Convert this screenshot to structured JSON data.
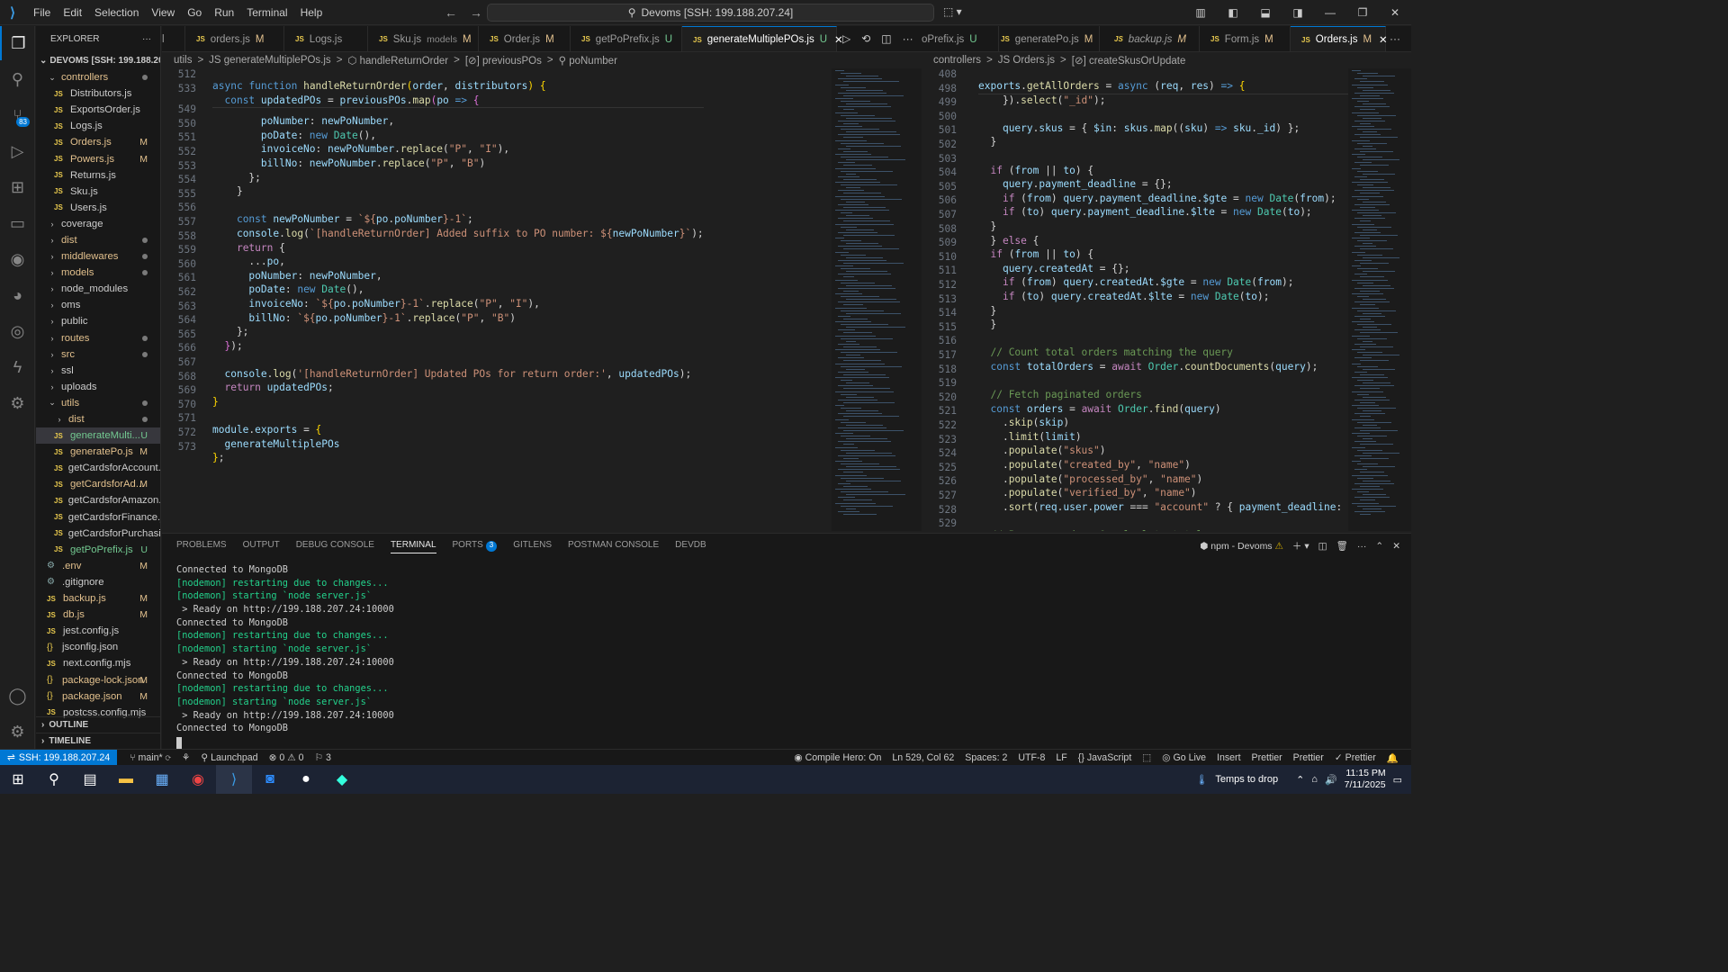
{
  "titlebar": {
    "menu": [
      "File",
      "Edit",
      "Selection",
      "View",
      "Go",
      "Run",
      "Terminal",
      "Help"
    ],
    "search": "Devoms [SSH: 199.188.207.24]"
  },
  "activity": {
    "source_control_badge": "83"
  },
  "explorer": {
    "title": "EXPLORER",
    "project": "DEVOMS [SSH: 199.188.20...",
    "rows": [
      {
        "label": "controllers",
        "type": "folder-open",
        "indent": 1,
        "dot": true
      },
      {
        "label": "Distributors.js",
        "type": "js",
        "indent": 2
      },
      {
        "label": "ExportsOrder.js",
        "type": "js",
        "indent": 2
      },
      {
        "label": "Logs.js",
        "type": "js",
        "indent": 2
      },
      {
        "label": "Orders.js",
        "type": "js",
        "indent": 2,
        "status": "M"
      },
      {
        "label": "Powers.js",
        "type": "js",
        "indent": 2,
        "status": "M"
      },
      {
        "label": "Returns.js",
        "type": "js",
        "indent": 2
      },
      {
        "label": "Sku.js",
        "type": "js",
        "indent": 2
      },
      {
        "label": "Users.js",
        "type": "js",
        "indent": 2
      },
      {
        "label": "coverage",
        "type": "folder",
        "indent": 1
      },
      {
        "label": "dist",
        "type": "folder",
        "indent": 1,
        "dot": true
      },
      {
        "label": "middlewares",
        "type": "folder",
        "indent": 1,
        "dot": true
      },
      {
        "label": "models",
        "type": "folder",
        "indent": 1,
        "dot": true
      },
      {
        "label": "node_modules",
        "type": "folder",
        "indent": 1
      },
      {
        "label": "oms",
        "type": "folder",
        "indent": 1
      },
      {
        "label": "public",
        "type": "folder",
        "indent": 1
      },
      {
        "label": "routes",
        "type": "folder",
        "indent": 1,
        "dot": true
      },
      {
        "label": "src",
        "type": "folder",
        "indent": 1,
        "dot": true
      },
      {
        "label": "ssl",
        "type": "folder",
        "indent": 1
      },
      {
        "label": "uploads",
        "type": "folder",
        "indent": 1
      },
      {
        "label": "utils",
        "type": "folder-open",
        "indent": 1,
        "dot": true
      },
      {
        "label": "dist",
        "type": "folder",
        "indent": 2,
        "dot": true
      },
      {
        "label": "generateMulti...",
        "type": "js",
        "indent": 2,
        "status": "U",
        "selected": true
      },
      {
        "label": "generatePo.js",
        "type": "js",
        "indent": 2,
        "status": "M"
      },
      {
        "label": "getCardsforAccount.js",
        "type": "js",
        "indent": 2
      },
      {
        "label": "getCardsforAd...",
        "type": "js",
        "indent": 2,
        "status": "M"
      },
      {
        "label": "getCardsforAmazon.js",
        "type": "js",
        "indent": 2
      },
      {
        "label": "getCardsforFinance.js",
        "type": "js",
        "indent": 2
      },
      {
        "label": "getCardsforPurchasi...",
        "type": "js",
        "indent": 2
      },
      {
        "label": "getPoPrefix.js",
        "type": "js",
        "indent": 2,
        "status": "U"
      },
      {
        "label": ".env",
        "type": "gear",
        "indent": 1,
        "status": "M"
      },
      {
        "label": ".gitignore",
        "type": "gear",
        "indent": 1
      },
      {
        "label": "backup.js",
        "type": "js",
        "indent": 1,
        "status": "M"
      },
      {
        "label": "db.js",
        "type": "js",
        "indent": 1,
        "status": "M"
      },
      {
        "label": "jest.config.js",
        "type": "js",
        "indent": 1
      },
      {
        "label": "jsconfig.json",
        "type": "json",
        "indent": 1
      },
      {
        "label": "next.config.mjs",
        "type": "js",
        "indent": 1
      },
      {
        "label": "package-lock.json",
        "type": "json",
        "indent": 1,
        "status": "M"
      },
      {
        "label": "package.json",
        "type": "json",
        "indent": 1,
        "status": "M"
      },
      {
        "label": "postcss.config.mjs",
        "type": "js",
        "indent": 1
      }
    ],
    "outline": "OUTLINE",
    "timeline": "TIMELINE"
  },
  "tabs_left": [
    {
      "label": "orders.js",
      "status": "M"
    },
    {
      "label": "Logs.js",
      "status": ""
    },
    {
      "label": "Sku.js",
      "sub": "models",
      "status": "M"
    },
    {
      "label": "Order.js",
      "status": "M"
    },
    {
      "label": "getPoPrefix.js",
      "status": "U"
    },
    {
      "label": "generateMultiplePOs.js",
      "status": "U",
      "active": true
    }
  ],
  "tabs_right": [
    {
      "label": "oPrefix.js",
      "status": "U"
    },
    {
      "label": "generatePo.js",
      "status": "M"
    },
    {
      "label": "backup.js",
      "status": "M"
    },
    {
      "label": "Form.js",
      "status": "M"
    },
    {
      "label": "Orders.js",
      "status": "M",
      "active": true
    }
  ],
  "breadcrumbs_left": [
    "utils",
    ">",
    "JS generateMultiplePOs.js",
    ">",
    "⬡ handleReturnOrder",
    ">",
    "[⊘] previousPOs",
    ">",
    "⚲ poNumber"
  ],
  "breadcrumbs_right": [
    "controllers",
    ">",
    "JS Orders.js",
    ">",
    "[⊘] createSkusOrUpdate"
  ],
  "left_lines": [
    "512",
    "533",
    "549",
    "550",
    "551",
    "552",
    "553",
    "554",
    "555",
    "556",
    "557",
    "558",
    "559",
    "560",
    "561",
    "562",
    "563",
    "564",
    "565",
    "566",
    "567",
    "568",
    "569",
    "570",
    "571",
    "572",
    "573"
  ],
  "right_lines": [
    "498",
    "499",
    "500",
    "501",
    "502",
    "503",
    "504",
    "505",
    "506",
    "507",
    "508",
    "509",
    "510",
    "511",
    "512",
    "513",
    "514",
    "515",
    "516",
    "517",
    "518",
    "519",
    "520",
    "521",
    "522",
    "523",
    "524",
    "525",
    "526",
    "527",
    "528",
    "529"
  ],
  "right_sticky_line": "408",
  "panel": {
    "tabs": [
      "PROBLEMS",
      "OUTPUT",
      "DEBUG CONSOLE",
      "TERMINAL",
      "PORTS",
      "GITLENS",
      "POSTMAN CONSOLE",
      "DEVDB"
    ],
    "ports_badge": "3",
    "terminal_name": "npm - Devoms",
    "terminal": [
      {
        "t": "Connected to MongoDB",
        "c": ""
      },
      {
        "t": "[nodemon] restarting due to changes...",
        "c": "tg"
      },
      {
        "t": "[nodemon] starting `node server.js`",
        "c": "tg"
      },
      {
        "t": " > Ready on http://199.188.207.24:10000",
        "c": ""
      },
      {
        "t": "Connected to MongoDB",
        "c": ""
      },
      {
        "t": "[nodemon] restarting due to changes...",
        "c": "tg"
      },
      {
        "t": "[nodemon] starting `node server.js`",
        "c": "tg"
      },
      {
        "t": " > Ready on http://199.188.207.24:10000",
        "c": ""
      },
      {
        "t": "Connected to MongoDB",
        "c": ""
      },
      {
        "t": "[nodemon] restarting due to changes...",
        "c": "tg"
      },
      {
        "t": "[nodemon] starting `node server.js`",
        "c": "tg"
      },
      {
        "t": " > Ready on http://199.188.207.24:10000",
        "c": ""
      },
      {
        "t": "Connected to MongoDB",
        "c": ""
      }
    ]
  },
  "status": {
    "remote": "SSH: 199.188.207.24",
    "branch": "main*",
    "launchpad": "Launchpad",
    "errors": "⊗ 0 ⚠ 0",
    "ports": "⚐ 3",
    "compile_hero": "Compile Hero: On",
    "position": "Ln 529, Col 62",
    "spaces": "Spaces: 2",
    "encoding": "UTF-8",
    "eol": "LF",
    "language": "JavaScript",
    "golive": "Go Live",
    "insert": "Insert",
    "prettier1": "Prettier",
    "prettier2": "Prettier",
    "prettier3": "✓ Prettier"
  },
  "taskbar": {
    "weather": "Temps to drop",
    "time": "11:15 PM",
    "date": "7/11/2025"
  }
}
